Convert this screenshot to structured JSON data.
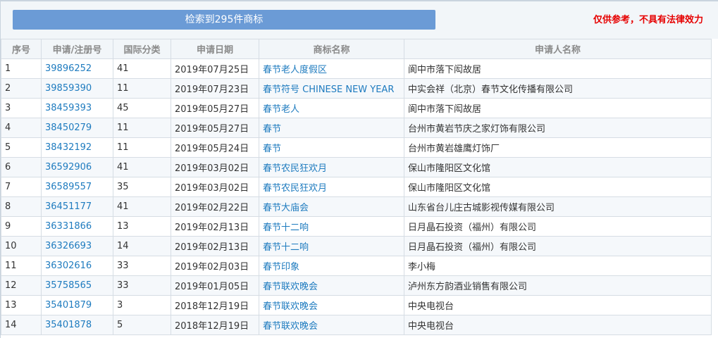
{
  "header": {
    "summary_label": "检索到295件商标",
    "disclaimer": "仅供参考，不具有法律效力"
  },
  "table": {
    "columns": [
      "序号",
      "申请/注册号",
      "国际分类",
      "申请日期",
      "商标名称",
      "申请人名称"
    ],
    "rows": [
      [
        "1",
        "39896252",
        "41",
        "2019年07月25日",
        "春节老人度假区",
        "阆中市落下闳故居"
      ],
      [
        "2",
        "39859390",
        "11",
        "2019年07月23日",
        "春节符号 CHINESE NEW YEAR",
        "中实会祥（北京）春节文化传播有限公司"
      ],
      [
        "3",
        "38459393",
        "45",
        "2019年05月27日",
        "春节老人",
        "阆中市落下闳故居"
      ],
      [
        "4",
        "38450279",
        "11",
        "2019年05月27日",
        "春节",
        "台州市黄岩节庆之家灯饰有限公司"
      ],
      [
        "5",
        "38432192",
        "11",
        "2019年05月24日",
        "春节",
        "台州市黄岩雄鹰灯饰厂"
      ],
      [
        "6",
        "36592906",
        "41",
        "2019年03月02日",
        "春节农民狂欢月",
        "保山市隆阳区文化馆"
      ],
      [
        "7",
        "36589557",
        "35",
        "2019年03月02日",
        "春节农民狂欢月",
        "保山市隆阳区文化馆"
      ],
      [
        "8",
        "36451177",
        "41",
        "2019年02月22日",
        "春节大庙会",
        "山东省台儿庄古城影视传媒有限公司"
      ],
      [
        "9",
        "36331866",
        "13",
        "2019年02月13日",
        "春节十二响",
        "日月晶石投资（福州）有限公司"
      ],
      [
        "10",
        "36326693",
        "14",
        "2019年02月13日",
        "春节十二响",
        "日月晶石投资（福州）有限公司"
      ],
      [
        "11",
        "36302616",
        "33",
        "2019年02月03日",
        "春节印象",
        "李小梅"
      ],
      [
        "12",
        "35758565",
        "33",
        "2019年01月05日",
        "春节联欢晚会",
        "泸州东方韵酒业销售有限公司"
      ],
      [
        "13",
        "35401879",
        "3",
        "2018年12月19日",
        "春节联欢晚会",
        "中央电视台"
      ],
      [
        "14",
        "35401878",
        "5",
        "2018年12月19日",
        "春节联欢晚会",
        "中央电视台"
      ]
    ]
  },
  "colors": {
    "button": "#6b9bd6",
    "disclaimer": "#e60000",
    "link": "#1e7bbf",
    "header_bg": "#f2f6f9"
  }
}
